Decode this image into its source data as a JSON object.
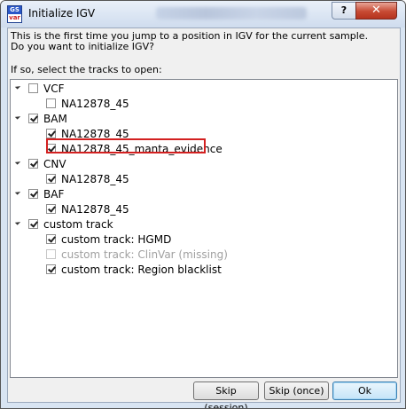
{
  "window": {
    "title": "Initialize IGV",
    "help_label": "?",
    "close_label": "✕",
    "app_icon_top": "GS",
    "app_icon_bottom": "var"
  },
  "message": {
    "line1": "This is the first time you jump to a position in IGV for the current sample.",
    "line2": "Do you want to initialize IGV?",
    "prompt": "If so, select the tracks to open:"
  },
  "tree": {
    "vcf": {
      "label": "VCF",
      "checked": false,
      "child": {
        "label": "NA12878_45",
        "checked": false
      }
    },
    "bam": {
      "label": "BAM",
      "checked": true,
      "child1": {
        "label": "NA12878_45",
        "checked": true
      },
      "child2": {
        "label": "NA12878_45_manta_evidence",
        "checked": true
      }
    },
    "cnv": {
      "label": "CNV",
      "checked": true,
      "child": {
        "label": "NA12878_45",
        "checked": true
      }
    },
    "baf": {
      "label": "BAF",
      "checked": true,
      "child": {
        "label": "NA12878_45",
        "checked": true
      }
    },
    "custom": {
      "label": "custom track",
      "checked": true,
      "child1": {
        "label": "custom track: HGMD",
        "checked": true
      },
      "child2": {
        "label": "custom track: ClinVar (missing)",
        "checked": false,
        "disabled": true
      },
      "child3": {
        "label": "custom track: Region blacklist",
        "checked": true
      }
    }
  },
  "buttons": {
    "skip_session": "Skip (session)",
    "skip_once": "Skip (once)",
    "ok": "Ok"
  },
  "colors": {
    "highlight": "#d32020",
    "title_bar": "#d8e4f2",
    "close": "#c74a33"
  }
}
